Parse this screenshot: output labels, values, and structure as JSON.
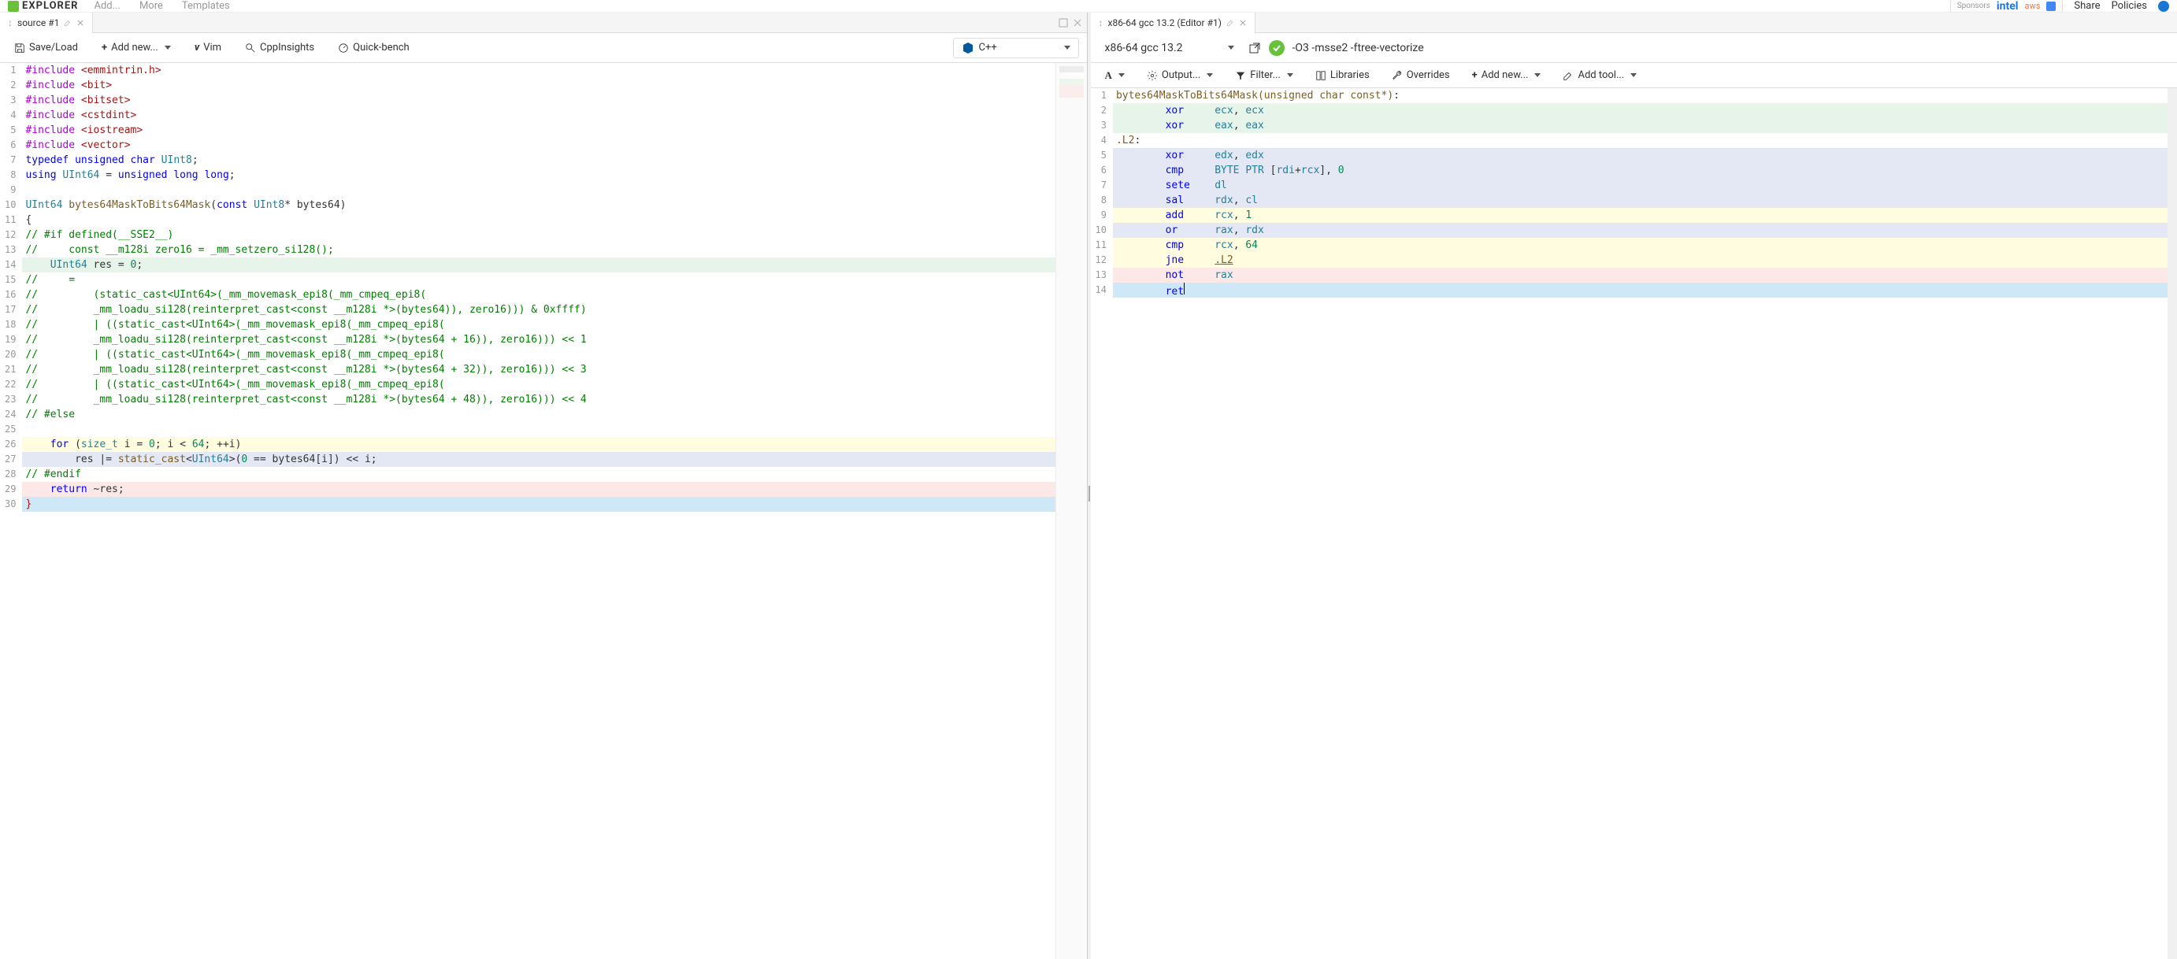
{
  "header": {
    "logo": "EXPLORER",
    "menu": [
      "Add...",
      "More",
      "Templates"
    ],
    "sponsor_logos": [
      "intel",
      "aws"
    ],
    "right_links": [
      "Share",
      "Policies"
    ]
  },
  "source_pane": {
    "tab_label": "source #1",
    "toolbar": {
      "save": "Save/Load",
      "add_new": "Add new...",
      "vim": "Vim",
      "cppinsights": "CppInsights",
      "quickbench": "Quick-bench"
    },
    "language": "C++",
    "code": [
      {
        "n": 1,
        "bg": "",
        "html": "<span class='pp'>#include</span> <span class='str'>&lt;emmintrin.h&gt;</span>"
      },
      {
        "n": 2,
        "bg": "",
        "html": "<span class='pp'>#include</span> <span class='str'>&lt;bit&gt;</span>"
      },
      {
        "n": 3,
        "bg": "",
        "html": "<span class='pp'>#include</span> <span class='str'>&lt;bitset&gt;</span>"
      },
      {
        "n": 4,
        "bg": "",
        "html": "<span class='pp'>#include</span> <span class='str'>&lt;cstdint&gt;</span>"
      },
      {
        "n": 5,
        "bg": "",
        "html": "<span class='pp'>#include</span> <span class='str'>&lt;iostream&gt;</span>"
      },
      {
        "n": 6,
        "bg": "",
        "html": "<span class='pp'>#include</span> <span class='str'>&lt;vector&gt;</span>"
      },
      {
        "n": 7,
        "bg": "",
        "html": "<span class='kw'>typedef</span> <span class='kw'>unsigned</span> <span class='kw'>char</span> <span class='type'>UInt8</span>;"
      },
      {
        "n": 8,
        "bg": "",
        "html": "<span class='kw'>using</span> <span class='type'>UInt64</span> = <span class='kw'>unsigned</span> <span class='kw'>long</span> <span class='kw'>long</span>;"
      },
      {
        "n": 9,
        "bg": "",
        "html": ""
      },
      {
        "n": 10,
        "bg": "",
        "html": "<span class='type'>UInt64</span> <span class='func'>bytes64MaskToBits64Mask</span>(<span class='kw'>const</span> <span class='type'>UInt8</span>* <span>bytes64</span>)"
      },
      {
        "n": 11,
        "bg": "",
        "html": "{"
      },
      {
        "n": 12,
        "bg": "",
        "html": "<span class='cmt'>// #if defined(__SSE2__)</span>"
      },
      {
        "n": 13,
        "bg": "",
        "html": "<span class='cmt'>//     const __m128i zero16 = _mm_setzero_si128();</span>"
      },
      {
        "n": 14,
        "bg": "bg-green",
        "html": "    <span class='type'>UInt64</span> res = <span class='num'>0</span>;"
      },
      {
        "n": 15,
        "bg": "",
        "html": "<span class='cmt'>//     =</span>"
      },
      {
        "n": 16,
        "bg": "",
        "html": "<span class='cmt'>//         (static_cast&lt;UInt64&gt;(_mm_movemask_epi8(_mm_cmpeq_epi8(</span>"
      },
      {
        "n": 17,
        "bg": "",
        "html": "<span class='cmt'>//         _mm_loadu_si128(reinterpret_cast&lt;const __m128i *&gt;(bytes64)), zero16))) &amp; 0xffff)</span>"
      },
      {
        "n": 18,
        "bg": "",
        "html": "<span class='cmt'>//         | ((static_cast&lt;UInt64&gt;(_mm_movemask_epi8(_mm_cmpeq_epi8(</span>"
      },
      {
        "n": 19,
        "bg": "",
        "html": "<span class='cmt'>//         _mm_loadu_si128(reinterpret_cast&lt;const __m128i *&gt;(bytes64 + 16)), zero16))) &lt;&lt; 1</span>"
      },
      {
        "n": 20,
        "bg": "",
        "html": "<span class='cmt'>//         | ((static_cast&lt;UInt64&gt;(_mm_movemask_epi8(_mm_cmpeq_epi8(</span>"
      },
      {
        "n": 21,
        "bg": "",
        "html": "<span class='cmt'>//         _mm_loadu_si128(reinterpret_cast&lt;const __m128i *&gt;(bytes64 + 32)), zero16))) &lt;&lt; 3</span>"
      },
      {
        "n": 22,
        "bg": "",
        "html": "<span class='cmt'>//         | ((static_cast&lt;UInt64&gt;(_mm_movemask_epi8(_mm_cmpeq_epi8(</span>"
      },
      {
        "n": 23,
        "bg": "",
        "html": "<span class='cmt'>//         _mm_loadu_si128(reinterpret_cast&lt;const __m128i *&gt;(bytes64 + 48)), zero16))) &lt;&lt; 4</span>"
      },
      {
        "n": 24,
        "bg": "",
        "html": "<span class='cmt'>// #else</span>"
      },
      {
        "n": 25,
        "bg": "",
        "html": ""
      },
      {
        "n": 26,
        "bg": "bg-yellow",
        "html": "    <span class='kw'>for</span> (<span class='type'>size_t</span> i = <span class='num'>0</span>; i &lt; <span class='num'>64</span>; ++i)"
      },
      {
        "n": 27,
        "bg": "bg-blue",
        "html": "        res |= <span class='func'>static_cast</span>&lt;<span class='type'>UInt64</span>&gt;(<span class='num'>0</span> == bytes64[i]) &lt;&lt; i;"
      },
      {
        "n": 28,
        "bg": "",
        "html": "<span class='cmt'>// #endif</span>"
      },
      {
        "n": 29,
        "bg": "bg-red",
        "html": "    <span class='kw'>return</span> ~res;"
      },
      {
        "n": 30,
        "bg": "bg-cursor",
        "html": "<span style='color:#a31515'>}</span>"
      }
    ]
  },
  "asm_pane": {
    "tab_label": "x86-64 gcc 13.2 (Editor #1)",
    "compiler": "x86-64 gcc 13.2",
    "compiler_options": "-O3  -msse2 -ftree-vectorize",
    "toolbar": {
      "output": "Output...",
      "filter": "Filter...",
      "libraries": "Libraries",
      "overrides": "Overrides",
      "add_new": "Add new...",
      "add_tool": "Add tool..."
    },
    "code": [
      {
        "n": 1,
        "bg": "",
        "html": "<span class='asm-label'>bytes64MaskToBits64Mask(unsigned char const*)</span>:"
      },
      {
        "n": 2,
        "bg": "bg-green",
        "html": "        <span class='asm-kw'>xor</span>     <span class='asm-reg'>ecx</span>, <span class='asm-reg'>ecx</span>"
      },
      {
        "n": 3,
        "bg": "bg-green",
        "html": "        <span class='asm-kw'>xor</span>     <span class='asm-reg'>eax</span>, <span class='asm-reg'>eax</span>"
      },
      {
        "n": 4,
        "bg": "",
        "html": "<span class='asm-label'>.L2</span>:"
      },
      {
        "n": 5,
        "bg": "bg-blue",
        "html": "        <span class='asm-kw'>xor</span>     <span class='asm-reg'>edx</span>, <span class='asm-reg'>edx</span>"
      },
      {
        "n": 6,
        "bg": "bg-blue",
        "html": "        <span class='asm-kw'>cmp</span>     <span class='asm-dir'>BYTE</span> <span class='asm-dir'>PTR</span> [<span class='asm-reg'>rdi</span>+<span class='asm-reg'>rcx</span>], <span class='num'>0</span>"
      },
      {
        "n": 7,
        "bg": "bg-blue",
        "html": "        <span class='asm-kw'>sete</span>    <span class='asm-reg'>dl</span>"
      },
      {
        "n": 8,
        "bg": "bg-blue",
        "html": "        <span class='asm-kw'>sal</span>     <span class='asm-reg'>rdx</span>, <span class='asm-reg'>cl</span>"
      },
      {
        "n": 9,
        "bg": "bg-yellow",
        "html": "        <span class='asm-kw'>add</span>     <span class='asm-reg'>rcx</span>, <span class='num'>1</span>"
      },
      {
        "n": 10,
        "bg": "bg-blue",
        "html": "        <span class='asm-kw'>or</span>      <span class='asm-reg'>rax</span>, <span class='asm-reg'>rdx</span>"
      },
      {
        "n": 11,
        "bg": "bg-yellow",
        "html": "        <span class='asm-kw'>cmp</span>     <span class='asm-reg'>rcx</span>, <span class='num'>64</span>"
      },
      {
        "n": 12,
        "bg": "bg-yellow",
        "html": "        <span class='asm-kw'>jne</span>     <span class='asm-label' style='text-decoration:underline'>.L2</span>"
      },
      {
        "n": 13,
        "bg": "bg-red",
        "html": "        <span class='asm-kw'>not</span>     <span class='asm-reg'>rax</span>"
      },
      {
        "n": 14,
        "bg": "bg-cursor",
        "html": "        <span class='asm-kw'>ret</span><span style='border-right:1px solid #000;height:15px;display:inline-block'></span>"
      }
    ]
  }
}
